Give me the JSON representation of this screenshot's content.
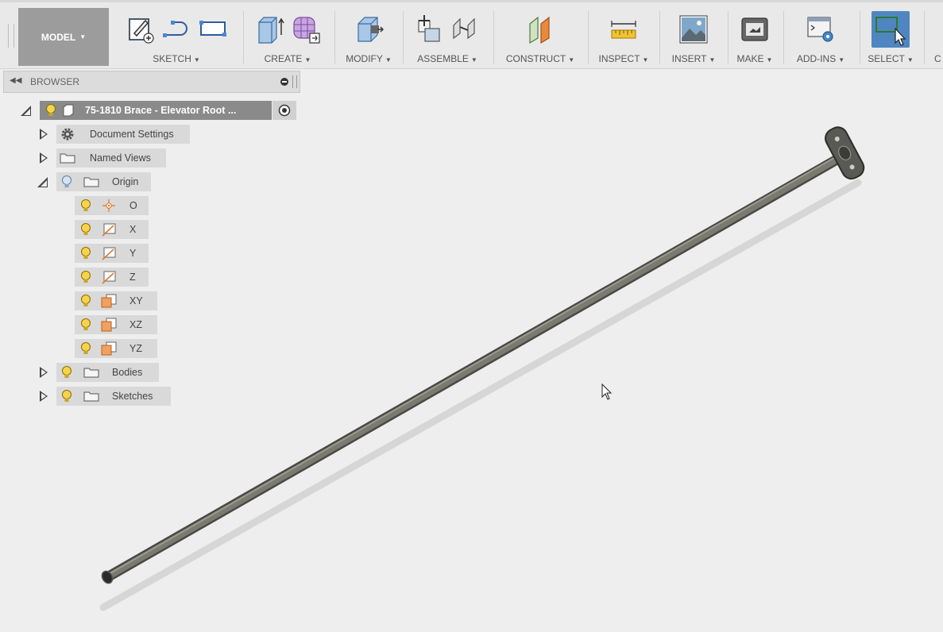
{
  "toolbar": {
    "model_label": "MODEL",
    "groups": {
      "sketch": "SKETCH",
      "create": "CREATE",
      "modify": "MODIFY",
      "assemble": "ASSEMBLE",
      "construct": "CONSTRUCT",
      "inspect": "INSPECT",
      "insert": "INSERT",
      "make": "MAKE",
      "addins": "ADD-INS",
      "select": "SELECT",
      "cutoff": "C"
    },
    "colors": {
      "active_select": "#4f86c0",
      "model_bg": "#9c9c9c"
    }
  },
  "browser": {
    "header": "BROWSER",
    "root": "75-1810 Brace - Elevator Root ...",
    "document_settings": "Document Settings",
    "named_views": "Named Views",
    "origin": "Origin",
    "origin_items": {
      "o": "O",
      "x": "X",
      "y": "Y",
      "z": "Z",
      "xy": "XY",
      "xz": "XZ",
      "yz": "YZ"
    },
    "bodies": "Bodies",
    "sketches": "Sketches"
  }
}
